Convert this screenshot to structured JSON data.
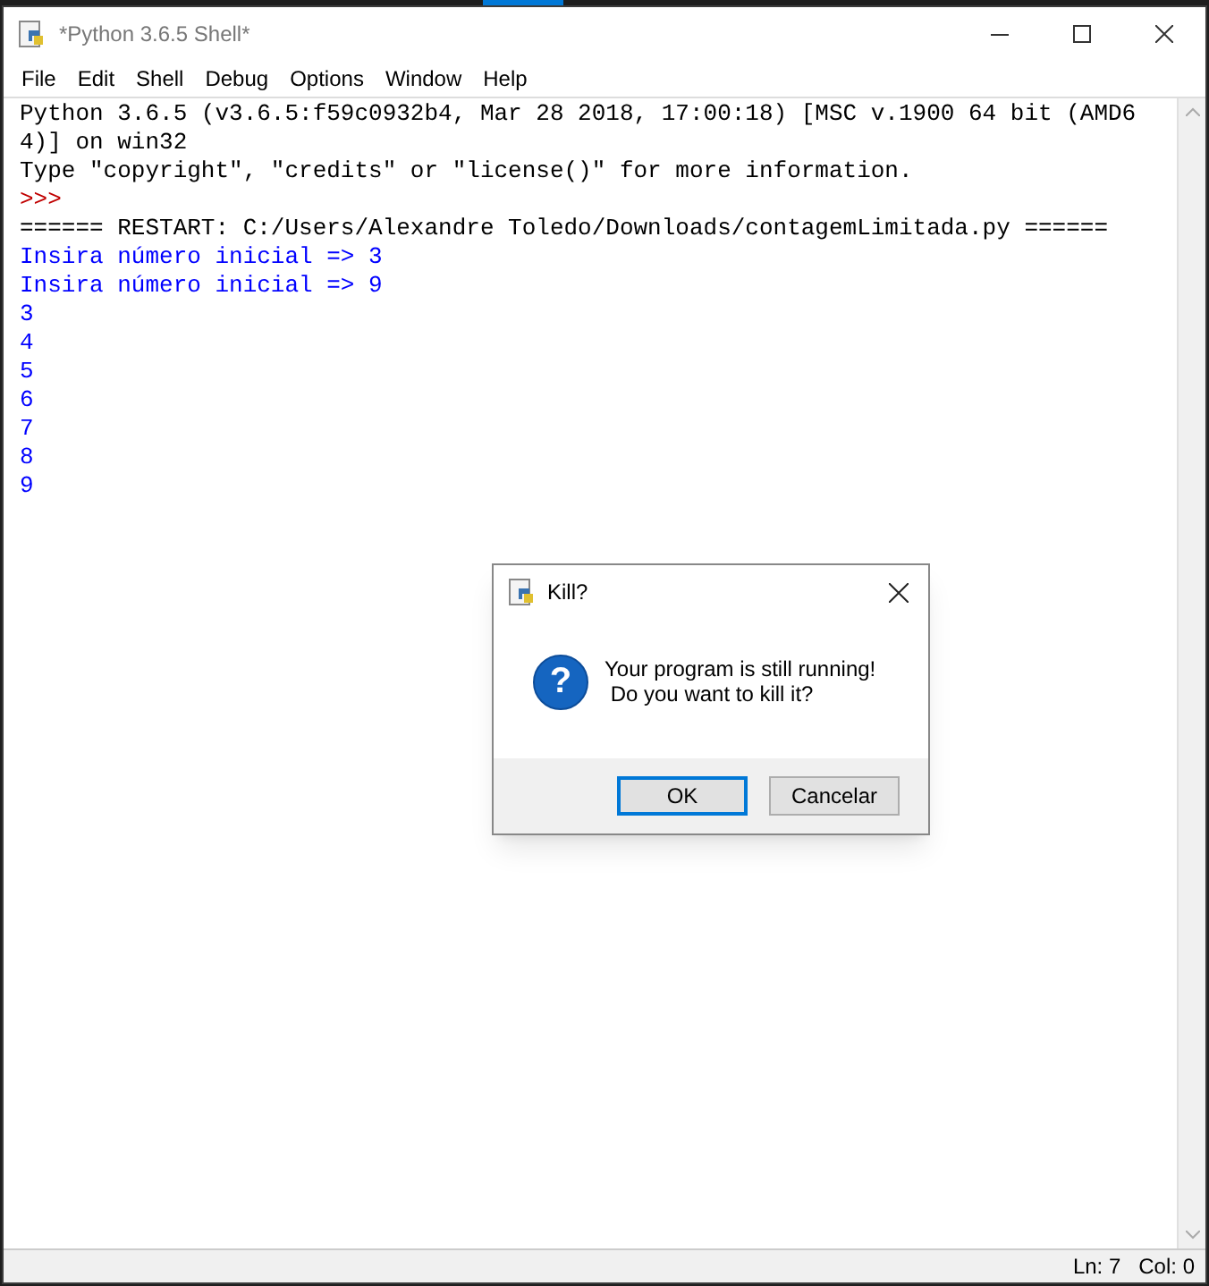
{
  "window": {
    "title": "*Python 3.6.5 Shell*"
  },
  "menu": [
    "File",
    "Edit",
    "Shell",
    "Debug",
    "Options",
    "Window",
    "Help"
  ],
  "lines": [
    {
      "kind": "stdout",
      "text": "Python 3.6.5 (v3.6.5:f59c0932b4, Mar 28 2018, 17:00:18) [MSC v.1900 64 bit (AMD6"
    },
    {
      "kind": "stdout",
      "text": "4)] on win32"
    },
    {
      "kind": "stdout",
      "text": "Type \"copyright\", \"credits\" or \"license()\" for more information."
    },
    {
      "kind": "prompt",
      "text": ">>>"
    },
    {
      "kind": "stdout",
      "text": "====== RESTART: C:/Users/Alexandre Toledo/Downloads/contagemLimitada.py ======"
    },
    {
      "kind": "output",
      "text": "Insira número inicial => 3"
    },
    {
      "kind": "output",
      "text": "Insira número inicial => 9"
    },
    {
      "kind": "output",
      "text": "3"
    },
    {
      "kind": "output",
      "text": "4"
    },
    {
      "kind": "output",
      "text": "5"
    },
    {
      "kind": "output",
      "text": "6"
    },
    {
      "kind": "output",
      "text": "7"
    },
    {
      "kind": "output",
      "text": "8"
    },
    {
      "kind": "output",
      "text": "9"
    }
  ],
  "dialog": {
    "title": "Kill?",
    "icon_glyph": "?",
    "message": [
      "Your program is still running!",
      " Do you want to kill it?"
    ],
    "buttons": [
      {
        "label": "OK",
        "selected": true
      },
      {
        "label": "Cancelar",
        "selected": false
      }
    ]
  },
  "status_bar": {
    "line": "Ln: 7",
    "column": "Col: 0"
  }
}
